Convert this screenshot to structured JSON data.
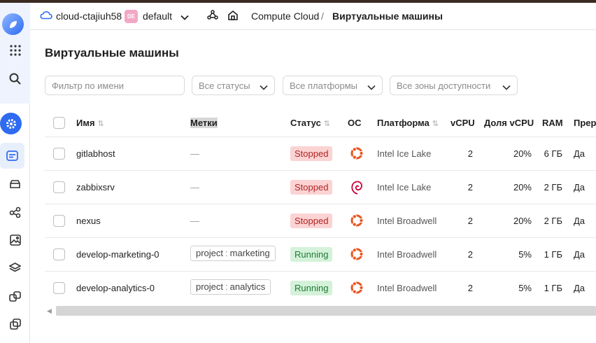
{
  "header": {
    "cloud_label": "cloud-ctajiuh58",
    "folder_badge": "DE",
    "folder_label": "default",
    "crumb_service": "Compute Cloud",
    "crumb_separator": "/",
    "crumb_page": "Виртуальные машины"
  },
  "page": {
    "title": "Виртуальные машины"
  },
  "filters": {
    "name_placeholder": "Фильтр по имени",
    "status": "Все статусы",
    "platform": "Все платформы",
    "zone": "Все зоны доступности"
  },
  "table": {
    "columns": {
      "name": "Имя",
      "labels": "Метки",
      "status": "Статус",
      "os": "ОС",
      "platform": "Платформа",
      "vcpu": "vCPU",
      "vcpu_share": "Доля vCPU",
      "ram": "RAM",
      "preemptible": "Прер"
    },
    "rows": [
      {
        "name": "gitlabhost",
        "label": "—",
        "status": "Stopped",
        "os": "ubuntu",
        "platform": "Intel Ice Lake",
        "vcpu": "2",
        "vcpu_share": "20%",
        "ram": "6 ГБ",
        "preemptible": "Да"
      },
      {
        "name": "zabbixsrv",
        "label": "—",
        "status": "Stopped",
        "os": "debian",
        "platform": "Intel Ice Lake",
        "vcpu": "2",
        "vcpu_share": "20%",
        "ram": "2 ГБ",
        "preemptible": "Да"
      },
      {
        "name": "nexus",
        "label": "—",
        "status": "Stopped",
        "os": "ubuntu",
        "platform": "Intel Broadwell",
        "vcpu": "2",
        "vcpu_share": "20%",
        "ram": "2 ГБ",
        "preemptible": "Да"
      },
      {
        "name": "develop-marketing-0",
        "label_key": "project",
        "label_sep": ":",
        "label_value": "marketing",
        "status": "Running",
        "os": "ubuntu",
        "platform": "Intel Broadwell",
        "vcpu": "2",
        "vcpu_share": "5%",
        "ram": "1 ГБ",
        "preemptible": "Да"
      },
      {
        "name": "develop-analytics-0",
        "label_key": "project",
        "label_sep": ":",
        "label_value": "analytics",
        "status": "Running",
        "os": "ubuntu",
        "platform": "Intel Broadwell",
        "vcpu": "2",
        "vcpu_share": "5%",
        "ram": "1 ГБ",
        "preemptible": "Да"
      }
    ]
  },
  "icons": {
    "logo": "yandex-cloud-logo-icon",
    "apps": "grid-icon",
    "search": "search-icon",
    "settings": "gear-icon",
    "os_ubuntu": "ubuntu-icon",
    "os_debian": "debian-icon"
  },
  "colors": {
    "accent": "#2e6bf0",
    "stopped_bg": "#fbd3d3",
    "stopped_text": "#b02424",
    "running_bg": "#d4f2d9",
    "running_text": "#1f7a34",
    "ubuntu": "#e95420",
    "debian": "#c70036"
  }
}
